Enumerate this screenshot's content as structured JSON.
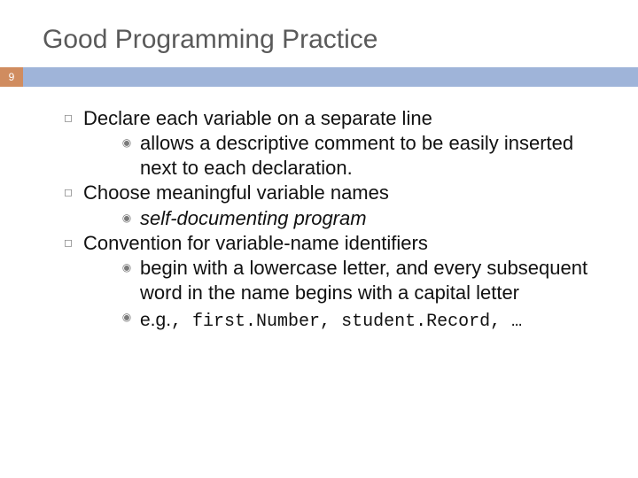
{
  "title": "Good Programming Practice",
  "page_number": "9",
  "bullets": {
    "b1": {
      "text": "Declare each variable on a separate line",
      "sub1": "allows a descriptive comment to be easily inserted next to each declaration."
    },
    "b2": {
      "text": "Choose meaningful variable names",
      "sub1": "self-documenting program"
    },
    "b3": {
      "text": "Convention for variable-name identifiers",
      "sub1": "begin with a lowercase letter, and every subsequent word in the name begins with a capital letter",
      "sub2_prefix": "e.g.",
      "sub2_code": ", first.Number, student.Record, …"
    }
  },
  "markers": {
    "square": "◻",
    "target": "◉"
  }
}
